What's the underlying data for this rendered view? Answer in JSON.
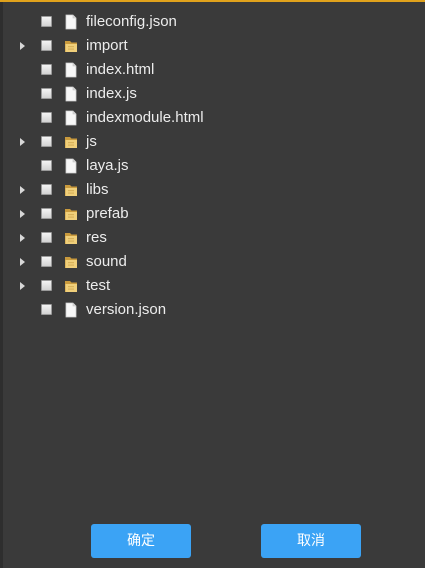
{
  "tree": {
    "items": [
      {
        "label": "fileconfig.json",
        "type": "file",
        "expandable": false
      },
      {
        "label": "import",
        "type": "folder",
        "expandable": true
      },
      {
        "label": "index.html",
        "type": "file",
        "expandable": false
      },
      {
        "label": "index.js",
        "type": "file",
        "expandable": false
      },
      {
        "label": "indexmodule.html",
        "type": "file",
        "expandable": false
      },
      {
        "label": "js",
        "type": "folder",
        "expandable": true
      },
      {
        "label": "laya.js",
        "type": "file",
        "expandable": false
      },
      {
        "label": "libs",
        "type": "folder",
        "expandable": true
      },
      {
        "label": "prefab",
        "type": "folder",
        "expandable": true
      },
      {
        "label": "res",
        "type": "folder",
        "expandable": true
      },
      {
        "label": "sound",
        "type": "folder",
        "expandable": true
      },
      {
        "label": "test",
        "type": "folder",
        "expandable": true
      },
      {
        "label": "version.json",
        "type": "file",
        "expandable": false
      }
    ]
  },
  "footer": {
    "ok_label": "确定",
    "cancel_label": "取消"
  },
  "colors": {
    "background": "#3a3a3a",
    "accent": "#e0a21c",
    "button": "#3ba3f5",
    "folder": "#e8c26a"
  }
}
